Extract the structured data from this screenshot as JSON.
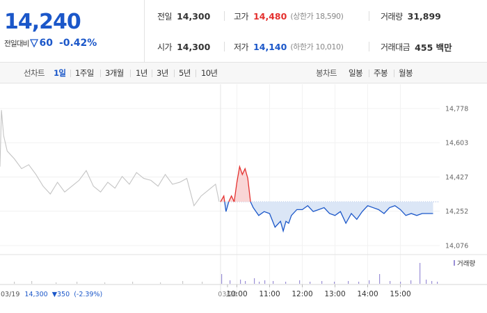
{
  "quote": {
    "price": "14,240",
    "change_label": "전일대비",
    "change_amount": "60",
    "change_rate": "-0.42%",
    "stats": {
      "prev_close": {
        "label": "전일",
        "value": "14,300"
      },
      "open": {
        "label": "시가",
        "value": "14,300"
      },
      "high": {
        "label": "고가",
        "value": "14,480",
        "limit": "(상한가 18,590)"
      },
      "low": {
        "label": "저가",
        "value": "14,140",
        "limit": "(하한가 10,010)"
      },
      "volume": {
        "label": "거래량",
        "value": "31,899"
      },
      "trade_value": {
        "label": "거래대금",
        "value": "455 백만"
      }
    }
  },
  "toolbar": {
    "line_chart_label": "선차트",
    "periods": [
      "1일",
      "1주일",
      "3개월",
      "1년",
      "3년",
      "5년",
      "10년"
    ],
    "active_period": "1일",
    "candle_chart_label": "봉차트",
    "candle_periods": [
      "일봉",
      "주봉",
      "월봉"
    ]
  },
  "chart_data": {
    "type": "line",
    "title": "",
    "xlabel": "",
    "ylabel": "",
    "baseline": 14300,
    "ylim": [
      14076,
      14778
    ],
    "y_ticks": [
      "14,778",
      "14,603",
      "14,427",
      "14,252",
      "14,076"
    ],
    "x_ticks": [
      "03/20",
      "10:00",
      "11:00",
      "12:00",
      "13:00",
      "14:00",
      "15:00"
    ],
    "prev_day": {
      "date": "03/19",
      "close": "14,300",
      "change": "▼350",
      "rate": "(-2.39%)",
      "x": [
        0,
        2,
        5,
        10,
        20,
        30,
        40,
        50,
        60,
        70,
        80,
        90,
        100,
        110,
        120,
        130,
        140,
        150,
        160,
        170,
        180,
        190,
        200,
        210,
        220,
        230,
        240,
        250,
        260,
        270,
        280,
        290,
        300,
        305
      ],
      "values": [
        14480,
        14770,
        14640,
        14560,
        14520,
        14470,
        14490,
        14440,
        14380,
        14340,
        14400,
        14350,
        14380,
        14410,
        14460,
        14380,
        14350,
        14400,
        14370,
        14430,
        14390,
        14450,
        14420,
        14410,
        14380,
        14440,
        14390,
        14400,
        14420,
        14280,
        14330,
        14360,
        14390,
        14300
      ]
    },
    "today": {
      "x_minutes": [
        0,
        6,
        10,
        15,
        20,
        25,
        30,
        35,
        40,
        45,
        50,
        55,
        60,
        65,
        70,
        80,
        90,
        100,
        110,
        115,
        120,
        125,
        130,
        140,
        150,
        160,
        170,
        180,
        190,
        200,
        210,
        220,
        230,
        240,
        250,
        260,
        270,
        280,
        290,
        300,
        310,
        320,
        330,
        340,
        350,
        360,
        370,
        380,
        390
      ],
      "values": [
        14300,
        14330,
        14250,
        14300,
        14330,
        14300,
        14400,
        14480,
        14440,
        14470,
        14420,
        14300,
        14270,
        14250,
        14230,
        14250,
        14240,
        14170,
        14200,
        14150,
        14200,
        14190,
        14230,
        14260,
        14260,
        14280,
        14250,
        14260,
        14270,
        14240,
        14230,
        14250,
        14190,
        14240,
        14210,
        14250,
        14280,
        14270,
        14260,
        14240,
        14270,
        14280,
        14260,
        14230,
        14240,
        14230,
        14240,
        14240,
        14240
      ]
    },
    "volume_legend": "거래량",
    "colors": {
      "up": "#e4302e",
      "down": "#1b57c9",
      "prev": "#c4c4c4",
      "up_fill": "#f9d6d6",
      "down_fill": "#dbe6f6"
    }
  }
}
